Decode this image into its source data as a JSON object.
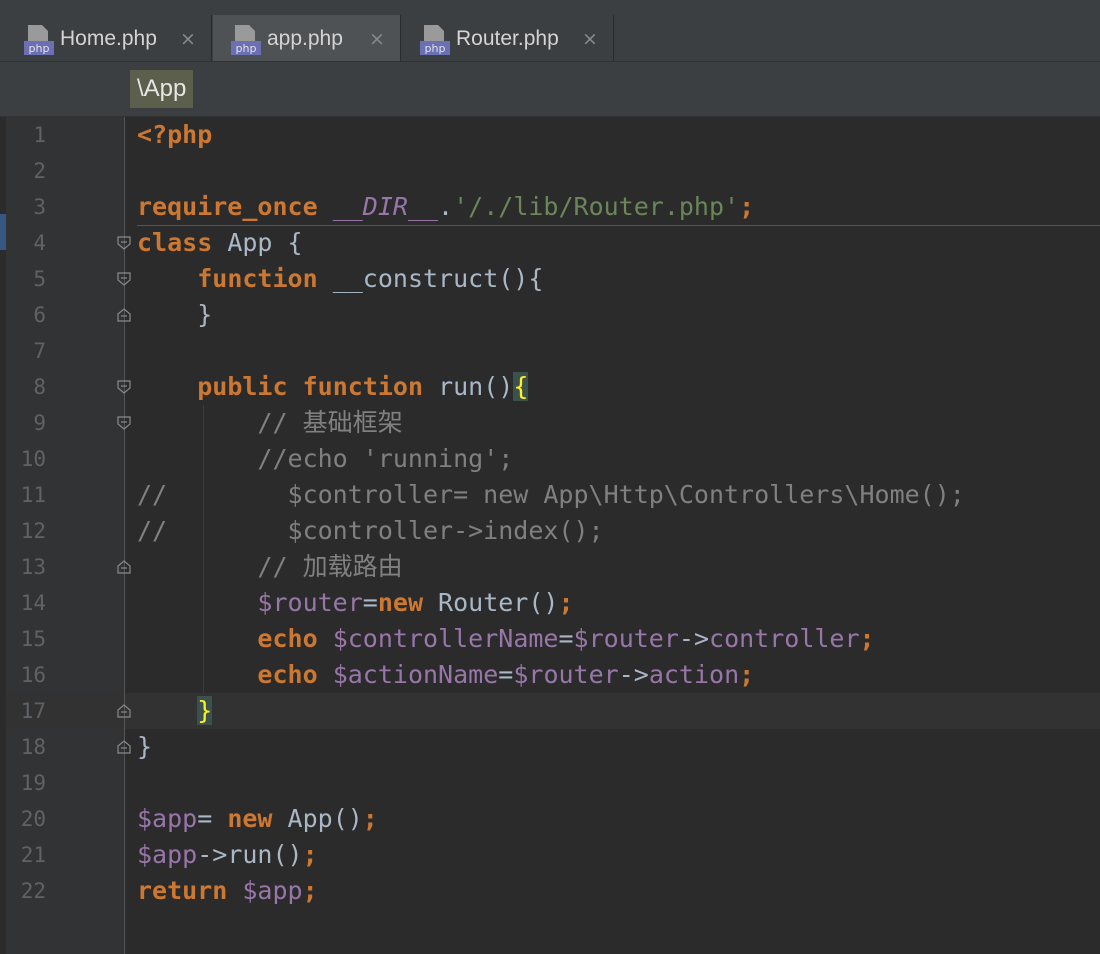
{
  "tabs": [
    {
      "label": "Home.php",
      "icon": "php-file-icon",
      "close": "×",
      "active": false
    },
    {
      "label": "app.php",
      "icon": "php-file-icon",
      "close": "×",
      "active": true
    },
    {
      "label": "Router.php",
      "icon": "php-file-icon",
      "close": "×",
      "active": false
    }
  ],
  "breadcrumb": "\\App",
  "line_numbers": [
    "1",
    "2",
    "3",
    "4",
    "5",
    "6",
    "7",
    "8",
    "9",
    "10",
    "11",
    "12",
    "13",
    "14",
    "15",
    "16",
    "17",
    "18",
    "19",
    "20",
    "21",
    "22"
  ],
  "code": {
    "l1": "<?php",
    "l3_kw": "require_once",
    "l3_const": "__DIR__",
    "l3_dot": ".",
    "l3_str": "'/./lib/Router.php'",
    "l3_semi": ";",
    "l4_kw": "class",
    "l4_rest": " App {",
    "l5_kw": "function",
    "l5_rest": " __construct(){",
    "l6": "}",
    "l8_kw1": "public",
    "l8_kw2": "function",
    "l8_rest": " run()",
    "l8_brace": "{",
    "l9": "// 基础框架",
    "l10": "//echo 'running';",
    "l11": "//        $controller= new App\\Http\\Controllers\\Home();",
    "l12": "//        $controller->index();",
    "l13": "// 加载路由",
    "l14_var": "$router",
    "l14_eq": "=",
    "l14_kw": "new",
    "l14_rest": " Router()",
    "l14_semi": ";",
    "l15_kw": "echo",
    "l15_var1": "$controllerName",
    "l15_eq": "=",
    "l15_var2": "$router",
    "l15_arrow": "->",
    "l15_prop": "controller",
    "l15_semi": ";",
    "l16_kw": "echo",
    "l16_var1": "$actionName",
    "l16_eq": "=",
    "l16_var2": "$router",
    "l16_arrow": "->",
    "l16_prop": "action",
    "l16_semi": ";",
    "l17": "}",
    "l18": "}",
    "l20_var": "$app",
    "l20_eq": "= ",
    "l20_kw": "new",
    "l20_rest": " App()",
    "l20_semi": ";",
    "l21_var": "$app",
    "l21_rest": "->run()",
    "l21_semi": ";",
    "l22_kw": "return",
    "l22_var": "$app",
    "l22_semi": ";"
  },
  "colors": {
    "keyword": "#cc7832",
    "variable": "#9876aa",
    "comment": "#808080",
    "string": "#6a8759",
    "default": "#a9b7c6"
  }
}
